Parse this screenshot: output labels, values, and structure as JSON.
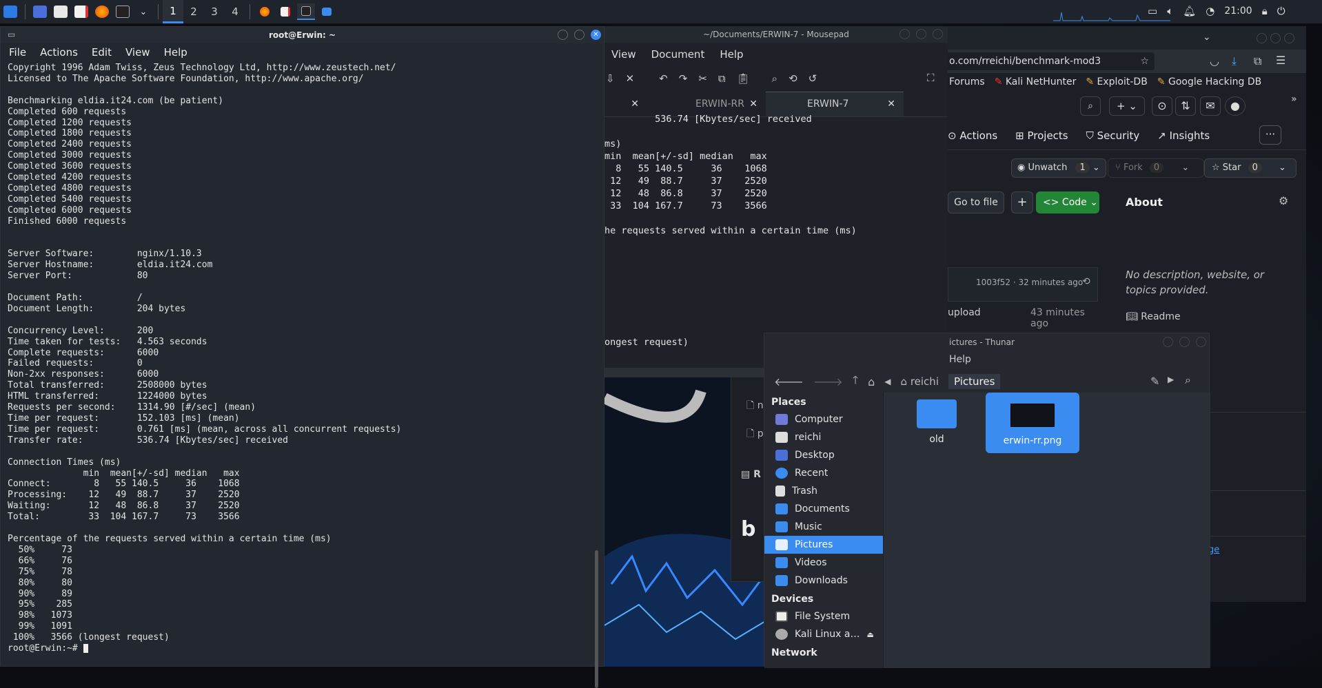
{
  "panel": {
    "workspaces": [
      "1",
      "2",
      "3",
      "4"
    ],
    "clock": "21:00"
  },
  "terminal": {
    "title": "root@Erwin: ~",
    "menu": [
      "File",
      "Actions",
      "Edit",
      "View",
      "Help"
    ],
    "lines": [
      "Copyright 1996 Adam Twiss, Zeus Technology Ltd, http://www.zeustech.net/",
      "Licensed to The Apache Software Foundation, http://www.apache.org/",
      "",
      "Benchmarking eldia.it24.com (be patient)",
      "Completed 600 requests",
      "Completed 1200 requests",
      "Completed 1800 requests",
      "Completed 2400 requests",
      "Completed 3000 requests",
      "Completed 3600 requests",
      "Completed 4200 requests",
      "Completed 4800 requests",
      "Completed 5400 requests",
      "Completed 6000 requests",
      "Finished 6000 requests",
      "",
      "",
      "Server Software:        nginx/1.10.3",
      "Server Hostname:        eldia.it24.com",
      "Server Port:            80",
      "",
      "Document Path:          /",
      "Document Length:        204 bytes",
      "",
      "Concurrency Level:      200",
      "Time taken for tests:   4.563 seconds",
      "Complete requests:      6000",
      "Failed requests:        0",
      "Non-2xx responses:      6000",
      "Total transferred:      2508000 bytes",
      "HTML transferred:       1224000 bytes",
      "Requests per second:    1314.90 [#/sec] (mean)",
      "Time per request:       152.103 [ms] (mean)",
      "Time per request:       0.761 [ms] (mean, across all concurrent requests)",
      "Transfer rate:          536.74 [Kbytes/sec] received",
      "",
      "Connection Times (ms)",
      "              min  mean[+/-sd] median   max",
      "Connect:        8   55 140.5     36    1068",
      "Processing:    12   49  88.7     37    2520",
      "Waiting:       12   48  86.8     37    2520",
      "Total:         33  104 167.7     73    3566",
      "",
      "Percentage of the requests served within a certain time (ms)",
      "  50%     73",
      "  66%     76",
      "  75%     78",
      "  80%     80",
      "  90%     89",
      "  95%    285",
      "  98%   1073",
      "  99%   1091",
      " 100%   3566 (longest request)",
      "root@Erwin:~# "
    ]
  },
  "mousepad": {
    "title": "~/Documents/ERWIN-7 - Mousepad",
    "menu": [
      "View",
      "Document",
      "Help"
    ],
    "tabs": [
      "",
      "ERWIN-RR",
      "ERWIN-7"
    ],
    "lines": [
      "         536.74 [Kbytes/sec] received",
      "",
      "ms)",
      "min  mean[+/-sd] median   max",
      "  8   55 140.5     36    1068",
      " 12   49  88.7     37    2520",
      " 12   48  86.8     37    2520",
      " 33  104 167.7     73    3566",
      "",
      "he requests served within a certain time (ms)",
      "",
      "",
      "",
      "",
      "",
      "",
      "",
      "",
      "ongest request)"
    ]
  },
  "firefox": {
    "url": "o.com/rreichi/benchmark-mod3",
    "bookmarks": [
      "Forums",
      "Kali NetHunter",
      "Exploit-DB",
      "Google Hacking DB"
    ],
    "repo_tabs": [
      "Actions",
      "Projects",
      "Security",
      "Insights"
    ],
    "unwatch": "Unwatch",
    "unwatch_count": "1",
    "fork": "Fork",
    "fork_count": "0",
    "star": "Star",
    "star_count": "0",
    "go_to_file": "Go to file",
    "code": "Code",
    "about_title": "About",
    "about_text": "No description, website, or topics provided.",
    "commit": "1003f52 · 32 minutes ago",
    "file_row": "upload",
    "file_time": "43 minutes ago",
    "readme": "Readme",
    "link_fragment": "ge"
  },
  "thunar": {
    "title": "ictures - Thunar",
    "menu": "Help",
    "path": [
      "reichi",
      "Pictures"
    ],
    "places_head": "Places",
    "places": [
      "Computer",
      "reichi",
      "Desktop",
      "Recent",
      "Trash",
      "Documents",
      "Music",
      "Pictures",
      "Videos",
      "Downloads"
    ],
    "devices_head": "Devices",
    "devices": [
      "File System",
      "Kali Linux a…"
    ],
    "network_head": "Network",
    "files": [
      "old",
      "erwin-rr.png"
    ]
  }
}
